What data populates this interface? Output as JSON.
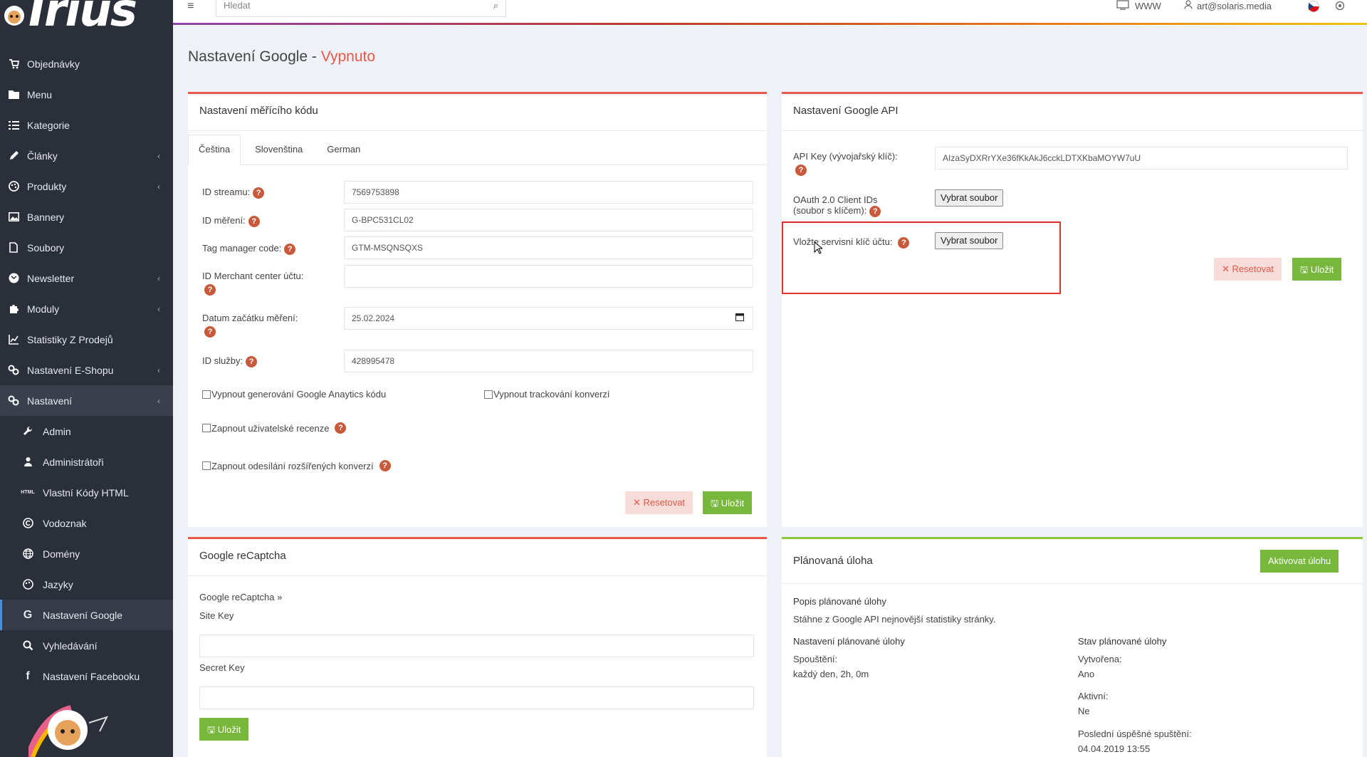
{
  "app": {
    "logo": "Irius",
    "reg": "®"
  },
  "sidebar": {
    "items": [
      {
        "label": "Objednávky",
        "icon": "cart-icon"
      },
      {
        "label": "Menu",
        "icon": "folder-icon"
      },
      {
        "label": "Kategorie",
        "icon": "list-icon"
      },
      {
        "label": "Články",
        "icon": "pencil-icon"
      },
      {
        "label": "Produkty",
        "icon": "palette-icon"
      },
      {
        "label": "Bannery",
        "icon": "image-icon"
      },
      {
        "label": "Soubory",
        "icon": "file-icon"
      },
      {
        "label": "Newsletter",
        "icon": "newsletter-icon"
      },
      {
        "label": "Moduly",
        "icon": "puzzle-icon"
      },
      {
        "label": "Statistiky Z Prodejů",
        "icon": "chart-icon"
      },
      {
        "label": "Nastavení E-Shopu",
        "icon": "cogs-icon"
      },
      {
        "label": "Nastavení",
        "icon": "cogs-icon"
      }
    ],
    "subitems": [
      {
        "label": "Admin",
        "icon": "wrench-icon"
      },
      {
        "label": "Administrátoři",
        "icon": "user-icon"
      },
      {
        "label": "Vlastní Kódy HTML",
        "icon": "html-icon"
      },
      {
        "label": "Vodoznak",
        "icon": "copyright-icon"
      },
      {
        "label": "Domény",
        "icon": "globe-icon"
      },
      {
        "label": "Jazyky",
        "icon": "language-icon"
      },
      {
        "label": "Nastavení Google",
        "icon": "google-icon"
      },
      {
        "label": "Vyhledávání",
        "icon": "search-icon"
      },
      {
        "label": "Nastavení Facebooku",
        "icon": "facebook-icon"
      }
    ]
  },
  "topbar": {
    "search_placeholder": "Hledat",
    "www": "WWW",
    "user": "art@solaris.media"
  },
  "page": {
    "title": "Nastavení Google - ",
    "state": "Vypnuto"
  },
  "measure": {
    "title": "Nastavení měřícího kódu",
    "tabs": [
      "Čeština",
      "Slovenština",
      "German"
    ],
    "fields": {
      "stream_label": "ID streamu:",
      "stream_value": "7569753898",
      "measure_label": "ID měření:",
      "measure_value": "G-BPC531CL02",
      "tag_label": "Tag manager code:",
      "tag_value": "GTM-MSQNSQXS",
      "merchant_label": "ID Merchant center účtu:",
      "merchant_value": "",
      "date_label": "Datum začátku měření:",
      "date_value": "25.02.2024",
      "service_label": "ID služby:",
      "service_value": "428995478"
    },
    "checks": {
      "analytics": "Vypnout generování Google Anaytics kódu",
      "conversions": "Vypnout trackování konverzí",
      "reviews": "Zapnout uživatelské recenze",
      "extended": "Zapnout odesílání rozšířených konverzí"
    },
    "reset": "Resetovat",
    "save": "Uložit"
  },
  "api": {
    "title": "Nastavení Google API",
    "key_label": "API Key (vývojařský klíč):",
    "key_value": "AIzaSyDXRrYXe36fKkAkJ6cckLDTXKbaMOYW7uU",
    "oauth_label_1": "OAuth 2.0 Client IDs",
    "oauth_label_2": "(soubor s klíčem):",
    "service_label": "Vložte servisní klíč účtu:",
    "file_button": "Vybrat soubor",
    "reset": "Resetovat",
    "save": "Uložit"
  },
  "recaptcha": {
    "title": "Google reCaptcha",
    "link": "Google reCaptcha »",
    "site_key_label": "Site Key",
    "secret_key_label": "Secret Key",
    "save": "Uložit"
  },
  "task": {
    "title": "Plánovaná úloha",
    "activate": "Aktivovat úlohu",
    "desc_title": "Popis plánované úlohy",
    "desc": "Stáhne z Google API nejnovější statistiky stránky.",
    "settings_title": "Nastavení plánované úlohy",
    "run_label": "Spouštění:",
    "run_value": "každý den, 2h, 0m",
    "state_title": "Stav plánované úlohy",
    "created_label": "Vytvořena:",
    "created_value": "Ano",
    "active_label": "Aktivní:",
    "active_value": "Ne",
    "last_label": "Poslední úspěšné spuštění:",
    "last_value": "04.04.2019 13:55"
  },
  "colors": {
    "accent_red": "#e8584a",
    "accent_green": "#77b83c",
    "sidebar_bg": "#2a2f3a"
  }
}
